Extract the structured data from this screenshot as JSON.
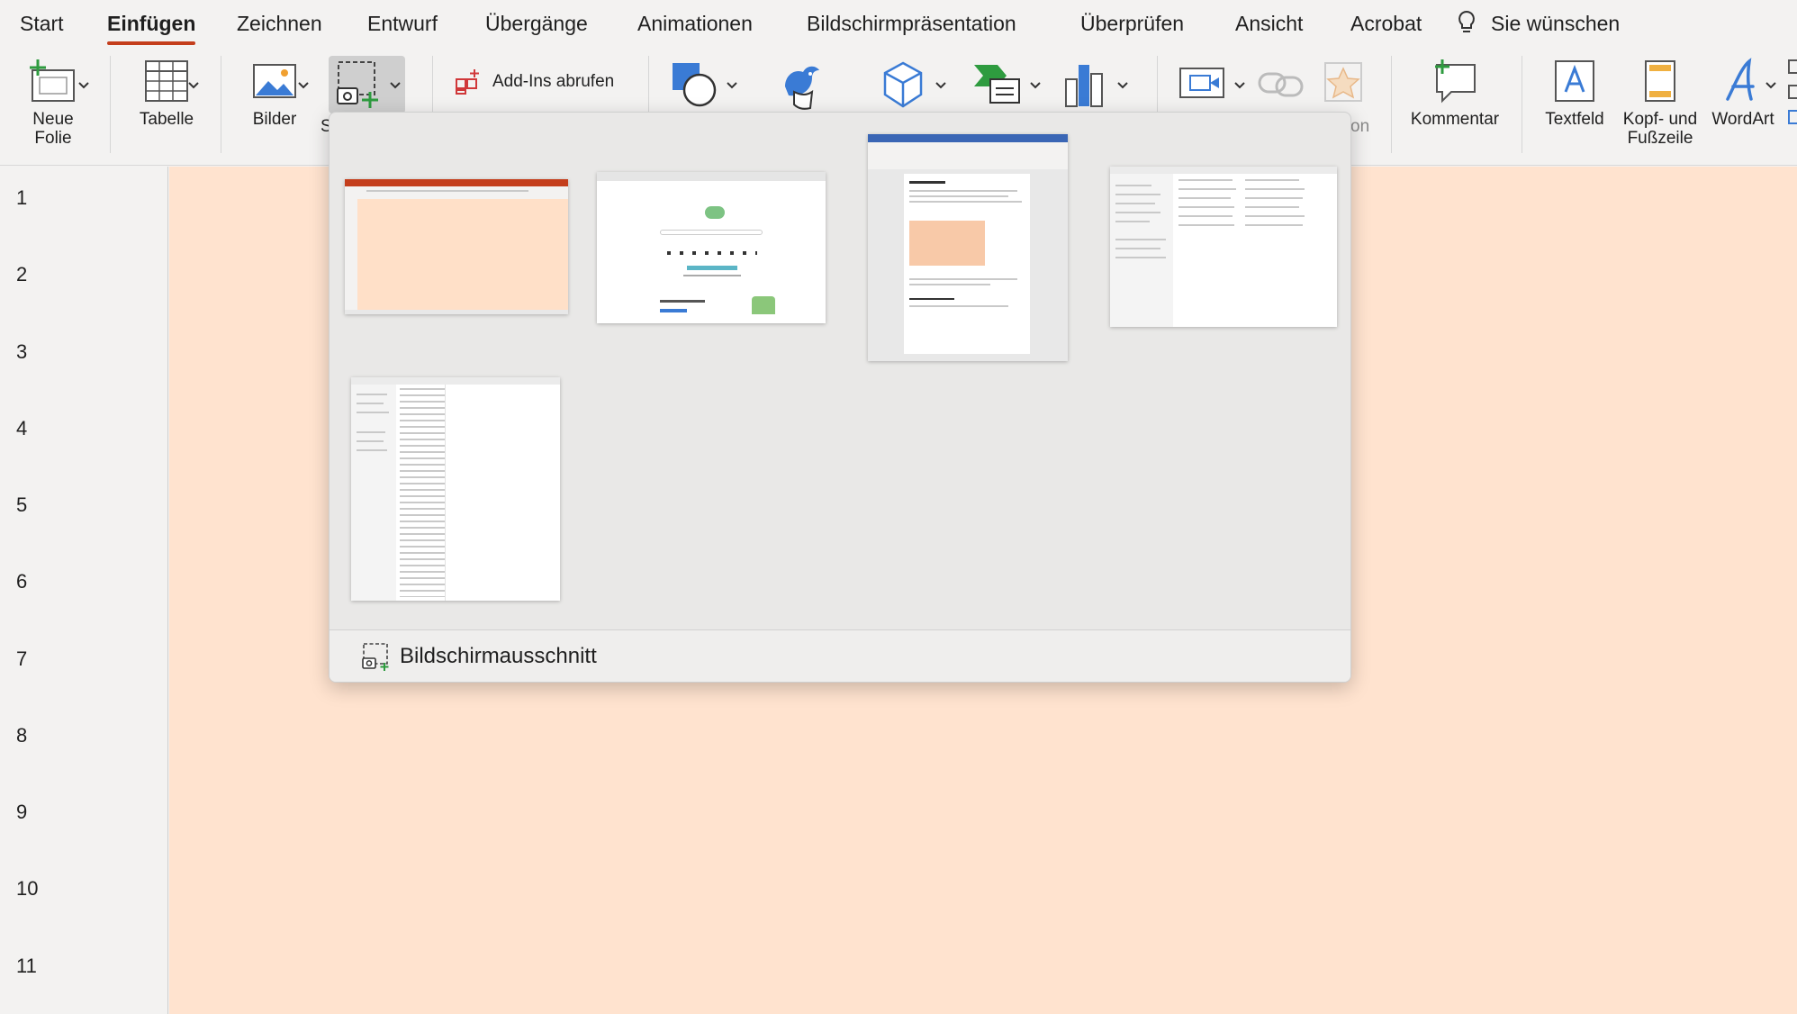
{
  "tabs": [
    "Start",
    "Einfügen",
    "Zeichnen",
    "Entwurf",
    "Übergänge",
    "Animationen",
    "Bildschirmpräsentation",
    "Überprüfen",
    "Ansicht",
    "Acrobat"
  ],
  "tell_me": "Sie wünschen",
  "ribbon": {
    "new_slide": "Neue\nFolie",
    "table": "Tabelle",
    "pictures": "Bilder",
    "screenshot_partial": "S",
    "addins": "Add-Ins abrufen",
    "icons_partial": "on",
    "comment": "Kommentar",
    "textbox": "Textfeld",
    "header_footer": "Kopf- und\nFußzeile",
    "wordart": "WordArt"
  },
  "slide_numbers": [
    "1",
    "2",
    "3",
    "4",
    "5",
    "6",
    "7",
    "8",
    "9",
    "10",
    "11"
  ],
  "dropdown": {
    "footer_label": "Bildschirmausschnitt"
  },
  "colors": {
    "accent": "#c43e1c",
    "slide_bg": "#ffe3cf",
    "ribbon_bg": "#f3f2f1"
  }
}
